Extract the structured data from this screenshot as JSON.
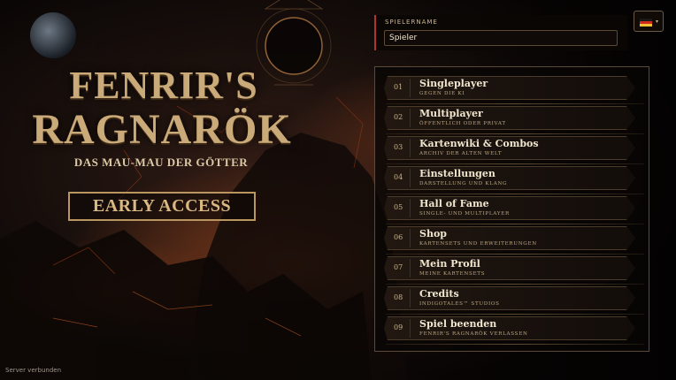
{
  "title": {
    "line1": "FENRIR'S",
    "line2": "RAGNARÖK",
    "subtitle": "DAS MAU-MAU DER GÖTTER"
  },
  "badge": {
    "label": "EARLY ACCESS"
  },
  "player": {
    "label": "SPIELERNAME",
    "value": "Spieler"
  },
  "language": {
    "icon": "german-flag-icon",
    "caret": "▾"
  },
  "menu": {
    "items": [
      {
        "num": "01",
        "label": "Singleplayer",
        "sub": "GEGEN DIE KI"
      },
      {
        "num": "02",
        "label": "Multiplayer",
        "sub": "ÖFFENTLICH ODER PRIVAT"
      },
      {
        "num": "03",
        "label": "Kartenwiki & Combos",
        "sub": "ARCHIV DER ALTEN WELT"
      },
      {
        "num": "04",
        "label": "Einstellungen",
        "sub": "DARSTELLUNG UND KLANG"
      },
      {
        "num": "05",
        "label": "Hall of Fame",
        "sub": "SINGLE- UND MULTIPLAYER"
      },
      {
        "num": "06",
        "label": "Shop",
        "sub": "KARTENSETS UND ERWEITERUNGEN"
      },
      {
        "num": "07",
        "label": "Mein Profil",
        "sub": "MEINE KARTENSETS"
      },
      {
        "num": "08",
        "label": "Credits",
        "sub": "INDIGOTALES™ STUDIOS"
      },
      {
        "num": "09",
        "label": "Spiel beenden",
        "sub": "FENRIR'S RAGNARÖK VERLASSEN"
      }
    ]
  },
  "status": {
    "text": "Server verbunden"
  },
  "colors": {
    "accent_gold": "#c9aa78",
    "border_red": "#b0362c",
    "ember": "#c84a1e"
  }
}
